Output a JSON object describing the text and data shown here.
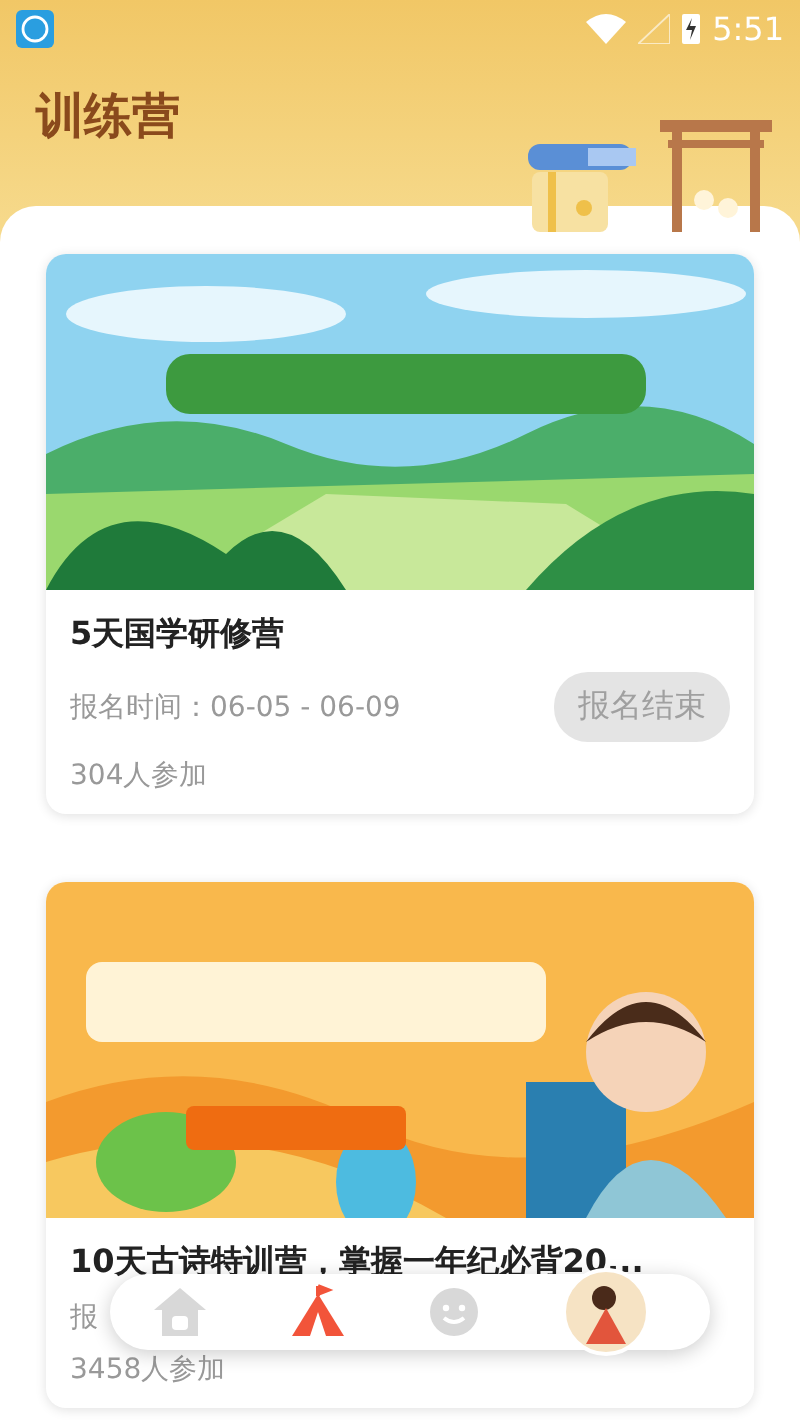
{
  "status_bar": {
    "time": "5:51"
  },
  "header": {
    "title": "训练营"
  },
  "camps": [
    {
      "banner": {
        "kind": "landscape"
      },
      "title": "5天国学研修营",
      "period": "报名时间：06-05 - 06-09",
      "participants": "304人参加",
      "button": {
        "label": "报名结束",
        "disabled": true
      }
    },
    {
      "banner": {
        "kind": "cartoon"
      },
      "title": "10天古诗特训营，掌握一年纪必背20...",
      "period": "报",
      "participants": "3458人参加"
    }
  ],
  "bottom_nav": [
    {
      "kind": "home",
      "selected": false
    },
    {
      "kind": "camp",
      "selected": true
    },
    {
      "kind": "face",
      "selected": false
    },
    {
      "kind": "avatar",
      "selected": false
    }
  ]
}
